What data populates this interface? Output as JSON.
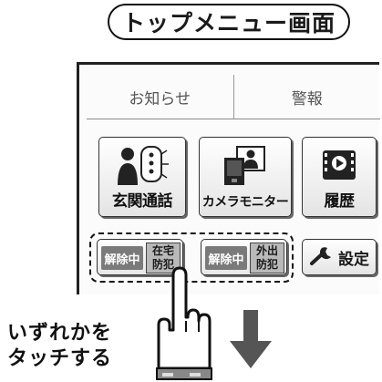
{
  "title": "トップメニュー画面",
  "tabs": [
    {
      "label": "お知らせ"
    },
    {
      "label": "警報"
    }
  ],
  "buttons": [
    {
      "label": "玄関通話",
      "icon": "intercom-icon"
    },
    {
      "label": "カメラモニター",
      "icon": "camera-monitor-icon"
    },
    {
      "label": "履歴",
      "icon": "history-icon"
    }
  ],
  "security": [
    {
      "state": "解除中",
      "mode_line1": "在宅",
      "mode_line2": "防犯"
    },
    {
      "state": "解除中",
      "mode_line1": "外出",
      "mode_line2": "防犯"
    }
  ],
  "settings": {
    "label": "設定",
    "icon": "wrench-icon"
  },
  "instruction": {
    "line1": "いずれかを",
    "line2": "タッチする"
  },
  "colors": {
    "state_bg": "#7a7a7a",
    "mode_bg": "#b9b9b9",
    "arrow": "#555555"
  }
}
